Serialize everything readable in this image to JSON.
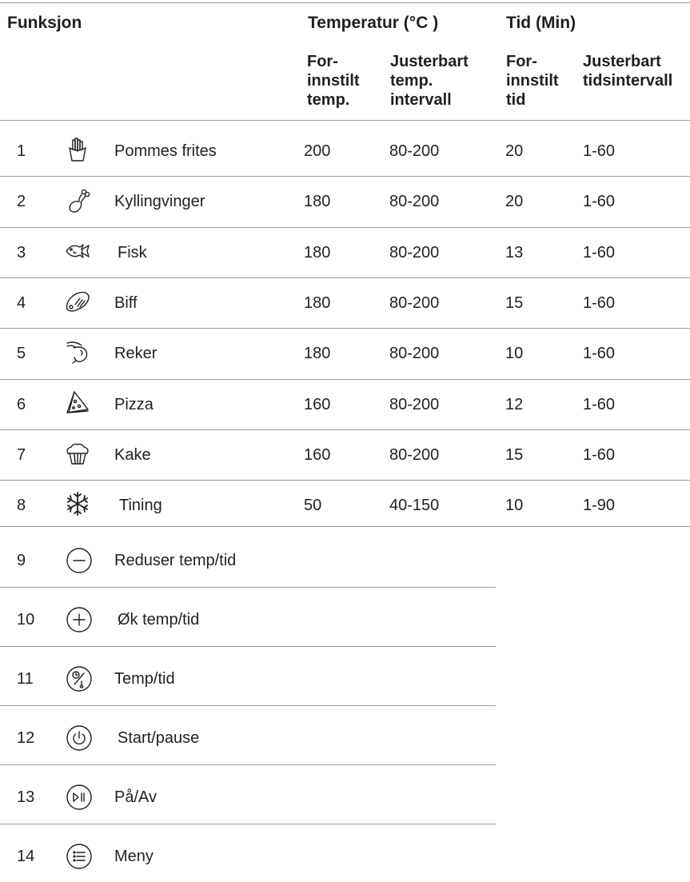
{
  "header": {
    "funksjon": "Funksjon",
    "temperatur": "Temperatur (°C )",
    "tid": "Tid (Min)",
    "temp_preset": [
      "For-",
      "innstilt",
      "temp."
    ],
    "temp_range": [
      "Justerbart",
      "temp.",
      "intervall"
    ],
    "time_preset": [
      "For-",
      "innstilt",
      "tid"
    ],
    "time_range": [
      "Justerbart",
      "tidsintervall"
    ]
  },
  "rows": [
    {
      "num": "1",
      "icon": "fries-icon",
      "label": "Pommes frites",
      "temp": "200",
      "temp_range": "80-200",
      "time": "20",
      "time_range": "1-60"
    },
    {
      "num": "2",
      "icon": "chicken-wing-icon",
      "label": "Kyllingvinger",
      "temp": "180",
      "temp_range": "80-200",
      "time": "20",
      "time_range": "1-60"
    },
    {
      "num": "3",
      "icon": "fish-icon",
      "label": "Fisk",
      "temp": "180",
      "temp_range": "80-200",
      "time": "13",
      "time_range": "1-60"
    },
    {
      "num": "4",
      "icon": "steak-icon",
      "label": "Biff",
      "temp": "180",
      "temp_range": "80-200",
      "time": "15",
      "time_range": "1-60"
    },
    {
      "num": "5",
      "icon": "shrimp-icon",
      "label": "Reker",
      "temp": "180",
      "temp_range": "80-200",
      "time": "10",
      "time_range": "1-60"
    },
    {
      "num": "6",
      "icon": "pizza-icon",
      "label": "Pizza",
      "temp": "160",
      "temp_range": "80-200",
      "time": "12",
      "time_range": "1-60"
    },
    {
      "num": "7",
      "icon": "cake-icon",
      "label": "Kake",
      "temp": "160",
      "temp_range": "80-200",
      "time": "15",
      "time_range": "1-60"
    },
    {
      "num": "8",
      "icon": "snowflake-icon",
      "label": "Tining",
      "temp": "50",
      "temp_range": "40-150",
      "time": "10",
      "time_range": "1-90"
    }
  ],
  "controls": [
    {
      "num": "9",
      "icon": "minus-icon",
      "label": "Reduser temp/tid"
    },
    {
      "num": "10",
      "icon": "plus-icon",
      "label": "Øk temp/tid"
    },
    {
      "num": "11",
      "icon": "temp-time-icon",
      "label": "Temp/tid"
    },
    {
      "num": "12",
      "icon": "power-icon",
      "label": "Start/pause"
    },
    {
      "num": "13",
      "icon": "play-pause-icon",
      "label": "På/Av"
    },
    {
      "num": "14",
      "icon": "menu-icon",
      "label": "Meny"
    }
  ]
}
